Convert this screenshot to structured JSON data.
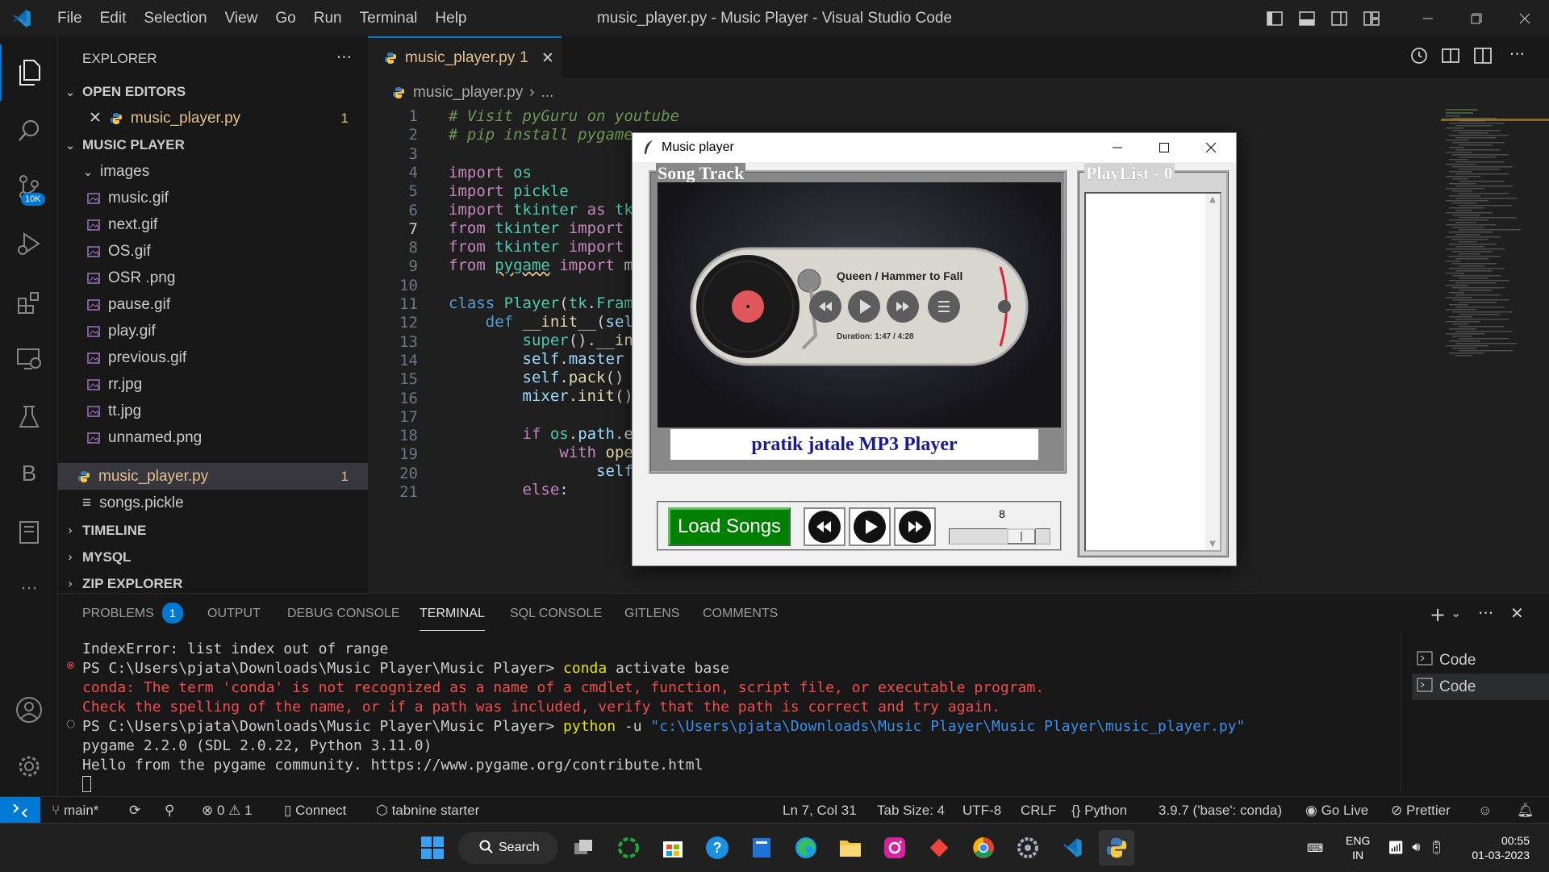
{
  "window": {
    "title": "music_player.py - Music Player - Visual Studio Code"
  },
  "menu": [
    "File",
    "Edit",
    "Selection",
    "View",
    "Go",
    "Run",
    "Terminal",
    "Help"
  ],
  "activity": {
    "source_control_badge": "10K"
  },
  "explorer": {
    "header": "EXPLORER",
    "more": "···",
    "open_editors_label": "OPEN EDITORS",
    "open_editor_file": "music_player.py",
    "open_editor_count": "1",
    "project_label": "MUSIC PLAYER",
    "folder_images": "images",
    "image_files": [
      "music.gif",
      "next.gif",
      "OS.gif",
      "OSR .png",
      "pause.gif",
      "play.gif",
      "previous.gif",
      "rr.jpg",
      "tt.jpg",
      "unnamed.png"
    ],
    "py_file": "music_player.py",
    "py_file_count": "1",
    "pickle_file": "songs.pickle",
    "timeline": "TIMELINE",
    "mysql": "MYSQL",
    "zip": "ZIP EXPLORER"
  },
  "editor": {
    "tab_label": "music_player.py",
    "tab_count": "1",
    "breadcrumb_file": "music_player.py",
    "breadcrumb_rest": "...",
    "line_numbers": [
      "1",
      "2",
      "3",
      "4",
      "5",
      "6",
      "7",
      "8",
      "9",
      "10",
      "11",
      "12",
      "13",
      "14",
      "15",
      "16",
      "17",
      "18",
      "19",
      "20",
      "21"
    ]
  },
  "music_player": {
    "title": "Music player",
    "song_track_label": "Song Track",
    "now_playing": "Queen / Hammer to Fall",
    "duration": "Duration: 1:47 / 4:28",
    "player_name": "pratik jatale MP3 Player",
    "load_button": "Load Songs",
    "volume_value": "8",
    "volume_level": 0.8,
    "playlist_label": "PlayList - 0"
  },
  "panel": {
    "tabs": [
      "PROBLEMS",
      "OUTPUT",
      "DEBUG CONSOLE",
      "TERMINAL",
      "SQL CONSOLE",
      "GITLENS",
      "COMMENTS"
    ],
    "problems_count": "1",
    "terminals": [
      "Code",
      "Code"
    ],
    "terminal_lines": {
      "l1": "IndexError: list index out of range",
      "l2_prompt": "PS C:\\Users\\pjata\\Downloads\\Music Player\\Music Player> ",
      "l2_cmd": "conda",
      "l2_args": " activate base",
      "l3": "conda: The term 'conda' is not recognized as a name of a cmdlet, function, script file, or executable program.",
      "l4": "Check the spelling of the name, or if a path was included, verify that the path is correct and try again.",
      "l5_prompt": "PS C:\\Users\\pjata\\Downloads\\Music Player\\Music Player> ",
      "l5_cmd": "python",
      "l5_flag": " -u ",
      "l5_path": "\"c:\\Users\\pjata\\Downloads\\Music Player\\Music Player\\music_player.py\"",
      "l6": "pygame 2.2.0 (SDL 2.0.22, Python 3.11.0)",
      "l7": "Hello from the pygame community. https://www.pygame.org/contribute.html"
    }
  },
  "status": {
    "branch": "main*",
    "errors": "0",
    "warnings": "1",
    "connect": "Connect",
    "tabnine": "tabnine starter",
    "position": "Ln 7, Col 31",
    "tabsize": "Tab Size: 4",
    "encoding": "UTF-8",
    "eol": "CRLF",
    "language": "Python",
    "interpreter": "3.9.7 ('base': conda)",
    "golive": "Go Live",
    "prettier": "Prettier"
  },
  "taskbar": {
    "search": "Search",
    "lang1": "ENG",
    "lang2": "IN",
    "time": "00:55",
    "date": "01-03-2023"
  },
  "colors": {
    "accent": "#0078d4",
    "modified": "#e2c08d",
    "load_button": "#008000"
  }
}
